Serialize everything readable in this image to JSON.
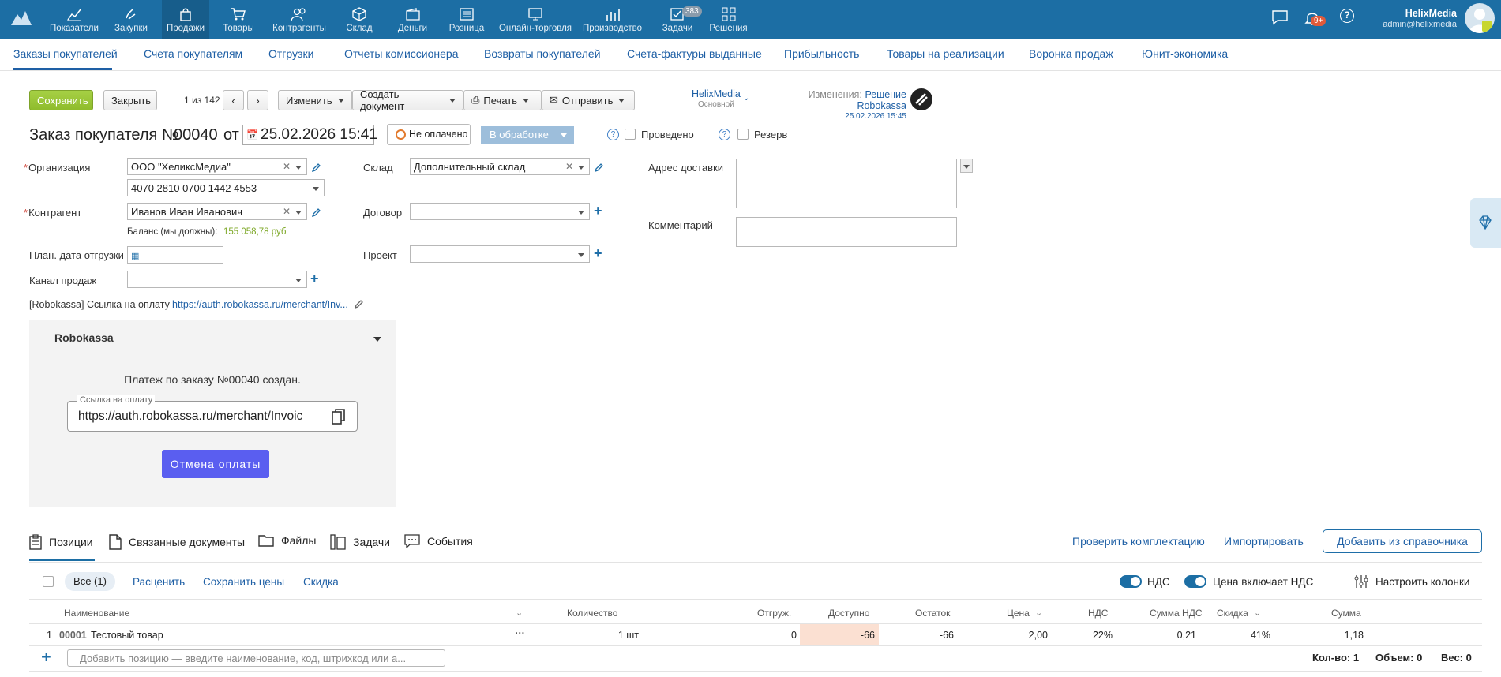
{
  "topnav": {
    "items": [
      {
        "label": "Показатели"
      },
      {
        "label": "Закупки"
      },
      {
        "label": "Продажи"
      },
      {
        "label": "Товары"
      },
      {
        "label": "Контрагенты"
      },
      {
        "label": "Склад"
      },
      {
        "label": "Деньги"
      },
      {
        "label": "Розница"
      },
      {
        "label": "Онлайн-торговля"
      },
      {
        "label": "Производство"
      },
      {
        "label": "Задачи"
      },
      {
        "label": "Решения"
      }
    ],
    "tasks_badge": "383",
    "notif_badge": "9+",
    "user_name": "HelixMedia",
    "user_email": "admin@helixmedia"
  },
  "subnav": {
    "items": [
      {
        "label": "Заказы покупателей"
      },
      {
        "label": "Счета покупателям"
      },
      {
        "label": "Отгрузки"
      },
      {
        "label": "Отчеты комиссионера"
      },
      {
        "label": "Возвраты покупателей"
      },
      {
        "label": "Счета-фактуры выданные"
      },
      {
        "label": "Прибыльность"
      },
      {
        "label": "Товары на реализации"
      },
      {
        "label": "Воронка продаж"
      },
      {
        "label": "Юнит-экономика"
      }
    ]
  },
  "toolbar": {
    "save": "Сохранить",
    "close": "Закрыть",
    "pager": "1 из 142",
    "change": "Изменить",
    "create_doc": "Создать документ",
    "print": "Печать",
    "send": "Отправить",
    "company": "HelixMedia",
    "company_sub": "Основной",
    "changes_label": "Изменения:",
    "changes_value": "Решение Robokassa",
    "changes_date": "25.02.2026 15:45"
  },
  "header": {
    "title": "Заказ покупателя №",
    "number": "00040",
    "from": "от",
    "date": "25.02.2026 15:41",
    "paid_status": "Не оплачено",
    "state": "В обработке",
    "posted": "Проведено",
    "reserve": "Резерв"
  },
  "form": {
    "org_label": "Организация",
    "org_value": "ООО \"ХеликсМедиа\"",
    "account_value": "4070 2810 0700 1442 4553",
    "counterparty_label": "Контрагент",
    "counterparty_value": "Иванов Иван Иванович",
    "balance_label": "Баланс (мы должны):",
    "balance_value": "155 058,78 руб",
    "ship_date_label": "План. дата отгрузки",
    "channel_label": "Канал продаж",
    "warehouse_label": "Склад",
    "warehouse_value": "Дополнительный склад",
    "contract_label": "Договор",
    "project_label": "Проект",
    "address_label": "Адрес доставки",
    "comment_label": "Комментарий",
    "robokassa_link_label": "[Robokassa] Ссылка на оплату",
    "robokassa_link_value": "https://auth.robokassa.ru/merchant/Inv..."
  },
  "robokassa": {
    "title": "Robokassa",
    "message": "Платеж по заказу №00040 создан.",
    "link_label": "Ссылка на оплату",
    "link_value": "https://auth.robokassa.ru/merchant/Invoic",
    "cancel": "Отмена оплаты"
  },
  "tabs": {
    "positions": "Позиции",
    "related": "Связанные документы",
    "files": "Файлы",
    "tasks": "Задачи",
    "events": "События",
    "check": "Проверить комплектацию",
    "import": "Импортировать",
    "add_from_catalog": "Добавить из справочника"
  },
  "positions_bar": {
    "all": "Все (1)",
    "reprice": "Расценить",
    "save_prices": "Сохранить цены",
    "discount": "Скидка",
    "vat": "НДС",
    "price_incl_vat": "Цена включает НДС",
    "configure": "Настроить колонки"
  },
  "table": {
    "columns": [
      "Наименование",
      "Количество",
      "Отгруж.",
      "Доступно",
      "Остаток",
      "Цена",
      "НДС",
      "Сумма НДС",
      "Скидка",
      "Сумма"
    ],
    "rows": [
      {
        "n": "1",
        "code": "00001",
        "name": "Тестовый товар",
        "qty": "1 шт",
        "shipped": "0",
        "available": "-66",
        "rest": "-66",
        "price": "2,00",
        "vat": "22%",
        "vat_sum": "0,21",
        "discount": "41%",
        "sum": "1,18"
      }
    ],
    "add_placeholder": "Добавить позицию — введите наименование, код, штрихкод или а...",
    "totals": {
      "qty": "Кол-во: 1",
      "volume": "Объем: 0",
      "weight": "Вес: 0"
    }
  }
}
